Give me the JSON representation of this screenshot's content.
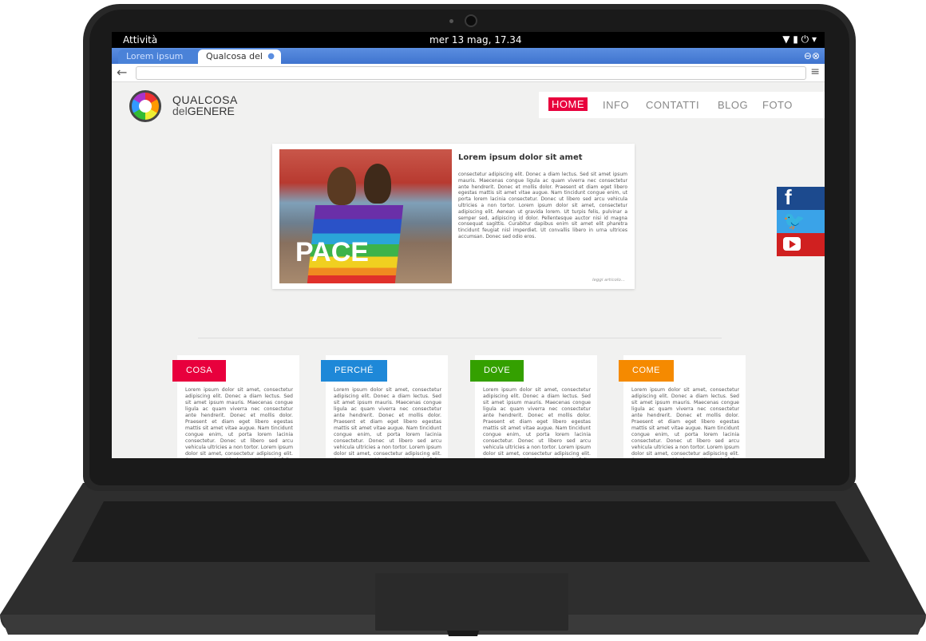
{
  "os": {
    "activities": "Attività",
    "clock": "mer 13 mag, 17.34",
    "tray": "▼ ▮ ⏻ ▾"
  },
  "browser": {
    "tabs": [
      {
        "label": "Lorem ipsum"
      },
      {
        "label": "Qualcosa del ..."
      }
    ],
    "close_icon": "●",
    "window_buttons": "⊖⊗",
    "back_icon": "←",
    "menu_icon": "≡"
  },
  "site": {
    "brand_line1": "QUALCOSA",
    "brand_line2_a": "del",
    "brand_line2_b": "GENERE",
    "nav": [
      "HOME",
      "INFO",
      "CONTATTI",
      "BLOG",
      "FOTO"
    ],
    "article": {
      "photo_text": "PACE",
      "title": "Lorem ipsum dolor sit amet",
      "body": "consectetur adipiscing elit. Donec a diam lectus. Sed sit amet ipsum mauris. Maecenas congue ligula ac quam viverra nec consectetur ante hendrerit. Donec et mollis dolor. Praesent et diam eget libero egestas mattis sit amet vitae augue. Nam tincidunt congue enim, ut porta lorem lacinia consectetur. Donec ut libero sed arcu vehicula ultricies a non tortor. Lorem ipsum dolor sit amet, consectetur adipiscing elit. Aenean ut gravida lorem. Ut turpis felis, pulvinar a semper sed, adipiscing id dolor. Pellentesque auctor nisi id magna consequat sagittis. Curabitur dapibus enim sit amet elit pharetra tincidunt feugiat nisl imperdiet. Ut convallis libero in urna ultrices accumsan. Donec sed odio eros.",
      "more": "leggi articolo..."
    },
    "cards": [
      {
        "title": "COSA",
        "body": "Lorem ipsum dolor sit amet, consectetur adipiscing elit. Donec a diam lectus. Sed sit amet ipsum mauris. Maecenas congue ligula ac quam viverra nec consectetur ante hendrerit. Donec et mollis dolor. Praesent et diam eget libero egestas mattis sit amet vitae augue. Nam tincidunt congue enim, ut porta lorem lacinia consectetur. Donec ut libero sed arcu vehicula ultricies a non tortor. Lorem ipsum dolor sit amet, consectetur adipiscing elit. Aenean ut gravida lorem. Ut turpis felis, pulvinar"
      },
      {
        "title": "PERCHÉ",
        "body": "Lorem ipsum dolor sit amet, consectetur adipiscing elit. Donec a diam lectus. Sed sit amet ipsum mauris. Maecenas congue ligula ac quam viverra nec consectetur ante hendrerit. Donec et mollis dolor. Praesent et diam eget libero egestas mattis sit amet vitae augue. Nam tincidunt congue enim, ut porta lorem lacinia consectetur. Donec ut libero sed arcu vehicula ultricies a non tortor. Lorem ipsum dolor sit amet, consectetur adipiscing elit. Aenean ut gravida lorem. Ut turpis felis, pulvinar"
      },
      {
        "title": "DOVE",
        "body": "Lorem ipsum dolor sit amet, consectetur adipiscing elit. Donec a diam lectus. Sed sit amet ipsum mauris. Maecenas congue ligula ac quam viverra nec consectetur ante hendrerit. Donec et mollis dolor. Praesent et diam eget libero egestas mattis sit amet vitae augue. Nam tincidunt congue enim, ut porta lorem lacinia consectetur. Donec ut libero sed arcu vehicula ultricies a non tortor. Lorem ipsum dolor sit amet, consectetur adipiscing elit. Aenean ut gravida lorem. Ut turpis felis, pulvinar"
      },
      {
        "title": "COME",
        "body": "Lorem ipsum dolor sit amet, consectetur adipiscing elit. Donec a diam lectus. Sed sit amet ipsum mauris. Maecenas congue ligula ac quam viverra nec consectetur ante hendrerit. Donec et mollis dolor. Praesent et diam eget libero egestas mattis sit amet vitae augue. Nam tincidunt congue enim, ut porta lorem lacinia consectetur. Donec ut libero sed arcu vehicula ultricies a non tortor. Lorem ipsum dolor sit amet, consectetur adipiscing elit. Aenean ut gravida lorem. Ut turpis felis, pulvinar"
      }
    ],
    "social": {
      "facebook": "f",
      "twitter": "🐦"
    }
  },
  "colors": {
    "home_accent": "#e8003d",
    "cosa": "#e8003d",
    "perche": "#1e88d8",
    "dove": "#34a000",
    "come": "#f58a00",
    "facebook": "#1c4a8e",
    "twitter": "#3aa3e8",
    "youtube": "#d02020"
  },
  "icons": {
    "social": [
      "facebook-icon",
      "twitter-icon",
      "youtube-icon"
    ]
  }
}
